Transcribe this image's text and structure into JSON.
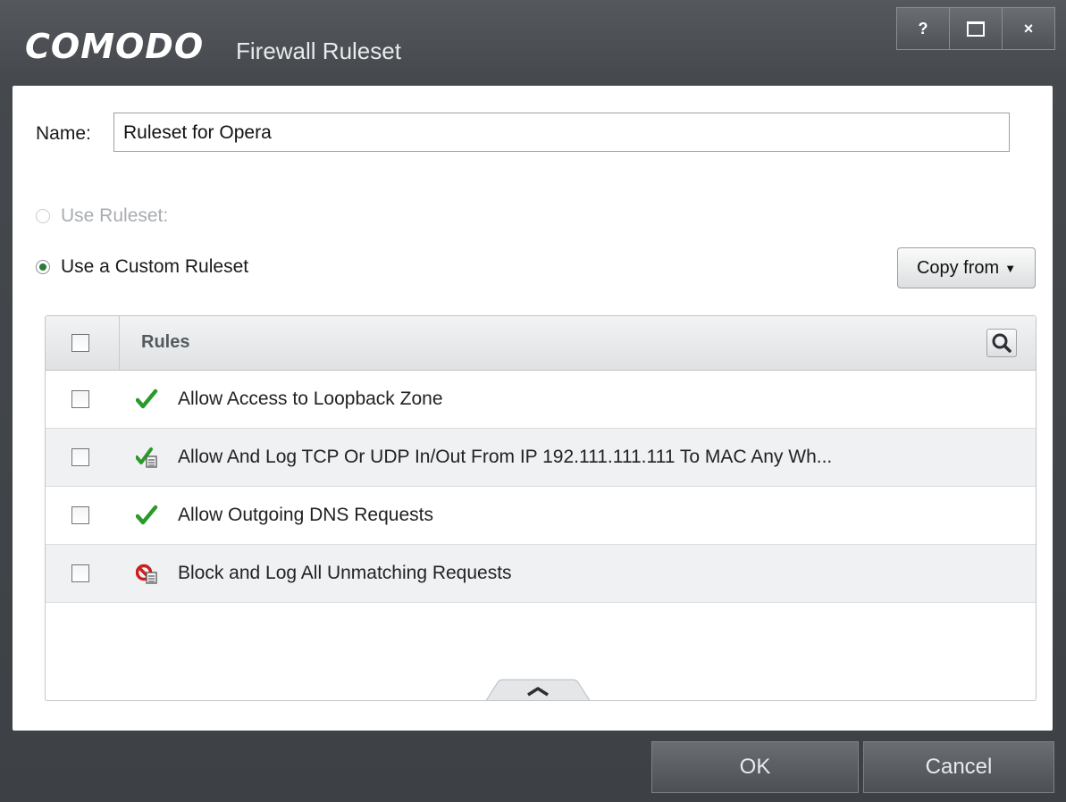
{
  "window": {
    "brand": "COMODO",
    "title": "Firewall Ruleset",
    "controls": {
      "help_label": "?",
      "close_label": "×"
    }
  },
  "form": {
    "name_label": "Name:",
    "name_value": "Ruleset for Opera",
    "option_predefined_label": "Use Ruleset:",
    "option_custom_label": "Use a Custom Ruleset",
    "selected_option": "custom",
    "copy_from_label": "Copy from",
    "copy_from_caret": "▼"
  },
  "grid": {
    "column_header": "Rules",
    "rows": [
      {
        "label": "Allow Access to Loopback Zone",
        "icon": "allow-icon"
      },
      {
        "label": "Allow And Log TCP Or UDP In/Out From IP 192.111.111.111 To MAC Any Wh...",
        "icon": "allow-log-icon"
      },
      {
        "label": "Allow Outgoing DNS Requests",
        "icon": "allow-icon"
      },
      {
        "label": "Block and Log All Unmatching Requests",
        "icon": "block-log-icon"
      }
    ]
  },
  "footer": {
    "ok_label": "OK",
    "cancel_label": "Cancel"
  },
  "colors": {
    "allow": "#2a9a2a",
    "block": "#cc1f1f",
    "chrome": "#45494d"
  }
}
